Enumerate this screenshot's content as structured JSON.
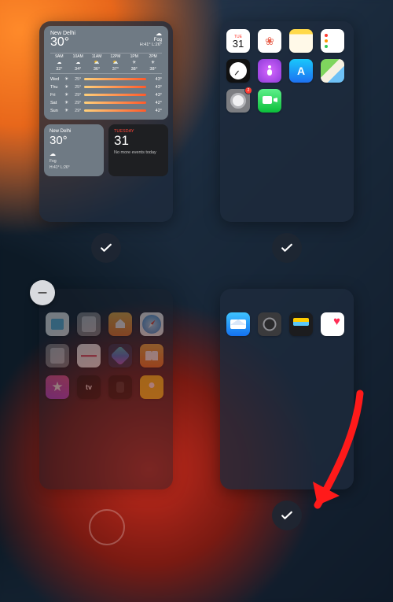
{
  "weather_large": {
    "city": "New Delhi",
    "temp": "30°",
    "cond": "Fog",
    "hilo": "H:41° L:26°",
    "hours": [
      {
        "h": "9AM",
        "i": "☁",
        "t": "32°"
      },
      {
        "h": "10AM",
        "i": "☁",
        "t": "34°"
      },
      {
        "h": "11AM",
        "i": "⛅",
        "t": "36°"
      },
      {
        "h": "12PM",
        "i": "⛅",
        "t": "37°"
      },
      {
        "h": "1PM",
        "i": "☀",
        "t": "38°"
      },
      {
        "h": "2PM",
        "i": "☀",
        "t": "38°"
      }
    ],
    "days": [
      {
        "d": "Wed",
        "lo": "25°",
        "hi": "43°"
      },
      {
        "d": "Thu",
        "lo": "25°",
        "hi": "43°"
      },
      {
        "d": "Fri",
        "lo": "29°",
        "hi": "43°"
      },
      {
        "d": "Sat",
        "lo": "29°",
        "hi": "42°"
      },
      {
        "d": "Sun",
        "lo": "29°",
        "hi": "42°"
      }
    ]
  },
  "weather_small": {
    "city": "New Delhi",
    "temp": "30°",
    "cond": "Fog",
    "hilo": "H:41° L:26°"
  },
  "calendar_small": {
    "weekday": "Tuesday",
    "day": "31",
    "note": "No more events today"
  },
  "calendar_icon": {
    "month": "TUE",
    "day": "31"
  },
  "settings_badge": "2",
  "pages": {
    "p1_selected": true,
    "p2_selected": true,
    "p3_selected": false,
    "p4_selected": true
  }
}
